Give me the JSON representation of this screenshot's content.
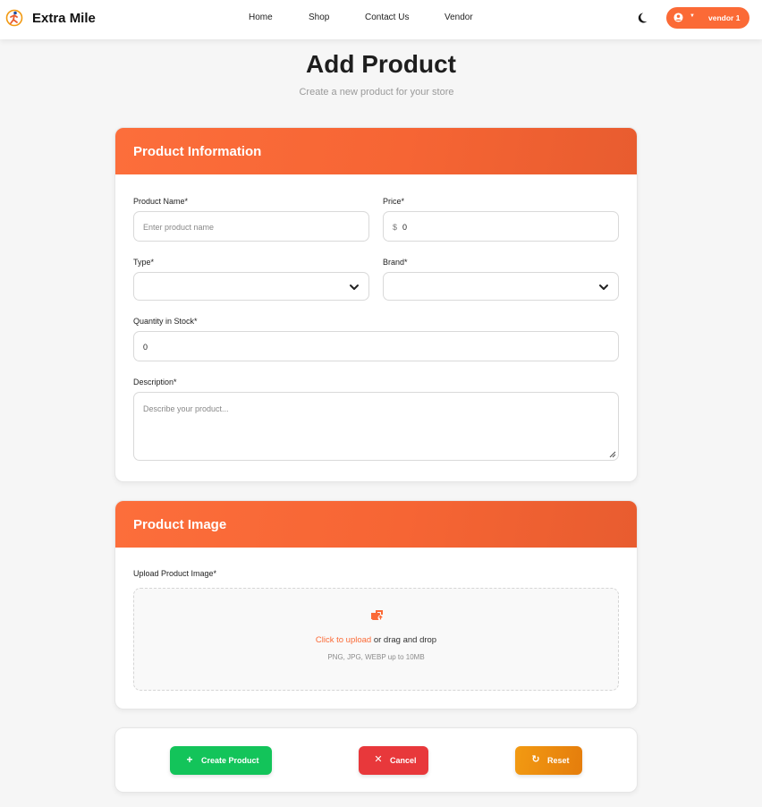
{
  "navbar": {
    "brand": "Extra Mile",
    "links": [
      {
        "label": "Home"
      },
      {
        "label": "Shop"
      },
      {
        "label": "Contact Us"
      },
      {
        "label": "Vendor"
      }
    ],
    "user": {
      "name": "vendor 1",
      "caret": "▼"
    },
    "icons": {
      "logo": "runner-logo-icon",
      "theme": "moon-icon",
      "user": "user-circle-icon"
    }
  },
  "page": {
    "title": "Add Product",
    "subtitle": "Create a new product for your store"
  },
  "product_info": {
    "title": "Product Information",
    "name": {
      "label": "Product Name*",
      "placeholder": "Enter product name",
      "value": ""
    },
    "price": {
      "label": "Price*",
      "prefix": "$",
      "value": "0"
    },
    "type": {
      "label": "Type*",
      "value": ""
    },
    "brand": {
      "label": "Brand*",
      "value": ""
    },
    "quantity": {
      "label": "Quantity in Stock*",
      "value": "0"
    },
    "description": {
      "label": "Description*",
      "placeholder": "Describe your product...",
      "value": ""
    }
  },
  "product_image": {
    "title": "Product Image",
    "label": "Upload Product Image*",
    "link": "Click to upload",
    "text": " or drag and drop",
    "hint": "PNG, JPG, WEBP up to 10MB"
  },
  "actions": {
    "create": {
      "label": "Create Product",
      "icon": "+"
    },
    "cancel": {
      "label": "Cancel",
      "icon": "✕"
    },
    "reset": {
      "label": "Reset",
      "icon": "↻"
    }
  },
  "colors": {
    "accent": "#fb6a36",
    "create": "#13c45a",
    "cancel": "#e8383b",
    "reset": "#ee8f10"
  }
}
